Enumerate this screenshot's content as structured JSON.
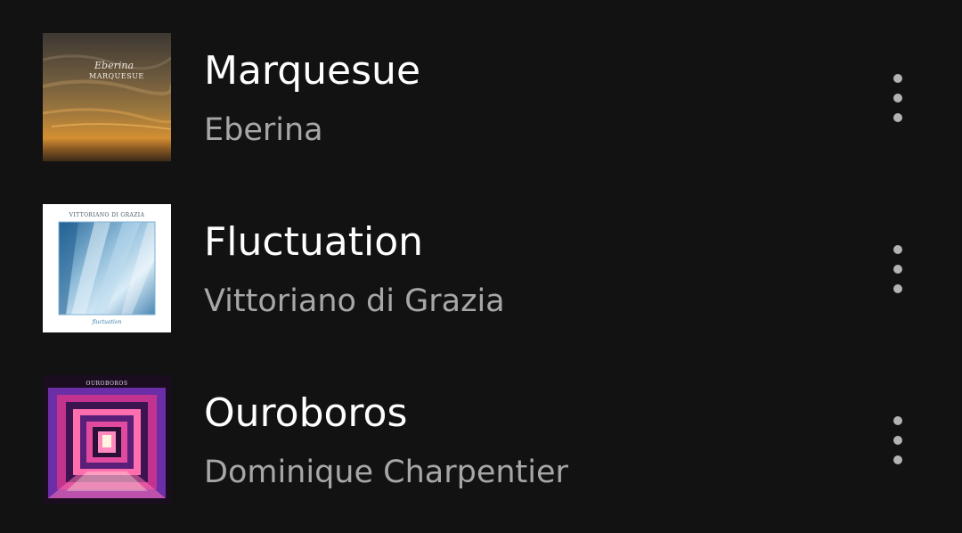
{
  "tracks": [
    {
      "title": "Marquesue",
      "artist": "Eberina",
      "cover_text_top": "Eberina",
      "cover_text_bottom": "MARQUESUE",
      "colors": {
        "sky_top": "#4a4238",
        "sky_mid": "#8a6a3e",
        "horizon": "#d38f32",
        "ground": "#3a2a18"
      }
    },
    {
      "title": "Fluctuation",
      "artist": "Vittoriano di Grazia",
      "cover_text_top": "VITTORIANO DI GRAZIA",
      "cover_text_bottom": "fluctuation",
      "colors": {
        "frame": "#ffffff",
        "ice_light": "#d9ecf7",
        "ice_mid": "#6fa3c8",
        "ice_dark": "#1f5d8f"
      }
    },
    {
      "title": "Ouroboros",
      "artist": "Dominique Charpentier",
      "cover_text_top": "OUROBOROS",
      "colors": {
        "outer": "#1a0d20",
        "magenta": "#c2338f",
        "violet": "#6b2ea6",
        "pink": "#ff6fb0",
        "light": "#fff4e0"
      }
    }
  ],
  "icons": {
    "more": "more-vertical-icon"
  },
  "theme": {
    "background": "#121212",
    "title": "#ffffff",
    "subtitle": "#a7a7a7",
    "dots": "#b3b3b3"
  }
}
